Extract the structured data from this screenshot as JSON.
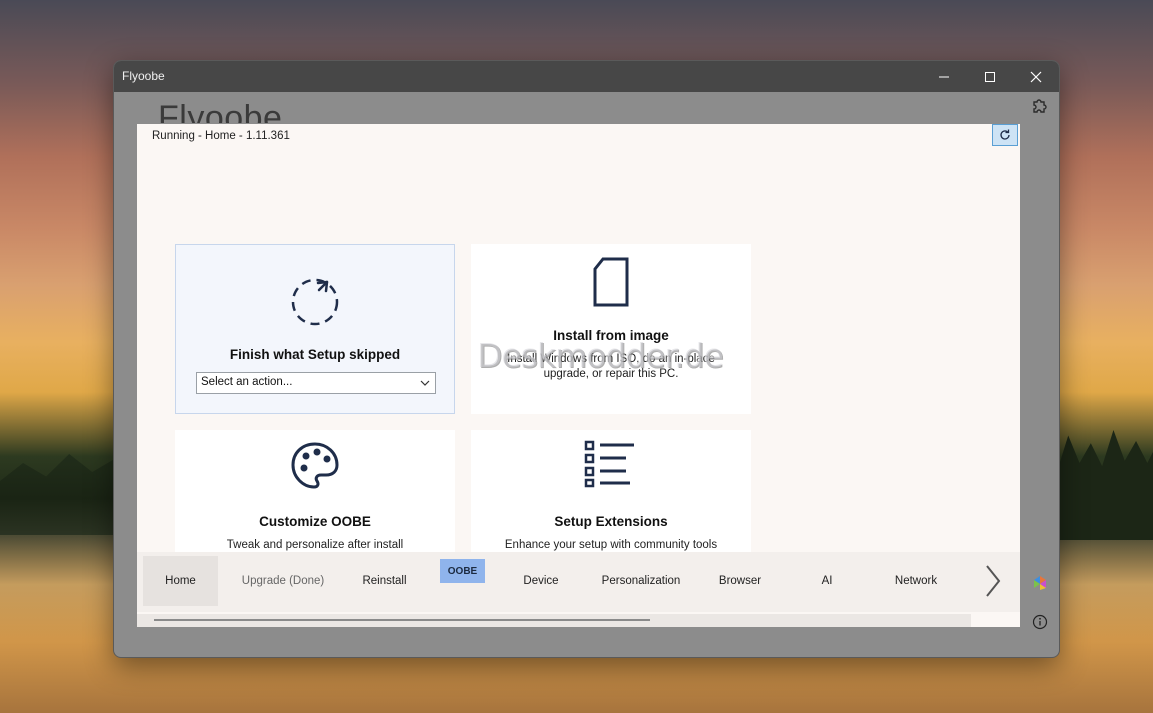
{
  "window": {
    "title": "Flyoobe",
    "background_title": "Flyoobe"
  },
  "status": "Running - Home - 1.11.361",
  "cards": [
    {
      "title": "Finish what Setup skipped",
      "select_placeholder": "Select an action...",
      "icon": "dashed-circle-arrow-icon"
    },
    {
      "title": "Install from image",
      "description": "Install Windows from ISO, do an in-place upgrade, or repair this PC.",
      "icon": "document-icon"
    },
    {
      "title": "Customize OOBE",
      "description": "Tweak and personalize after install",
      "icon": "palette-icon"
    },
    {
      "title": "Setup Extensions",
      "description": "Enhance your setup with community tools",
      "icon": "checklist-icon"
    }
  ],
  "nav": {
    "items": [
      "Home",
      "Upgrade (Done)",
      "Reinstall",
      "Device",
      "Personalization",
      "Browser",
      "AI",
      "Network"
    ],
    "badge": "OOBE",
    "active": "Home"
  },
  "watermark": "Deskmodder.de",
  "colors": {
    "accent": "#5a9fd4",
    "badge": "#8fb4ec",
    "icon": "#1f2d4a"
  }
}
